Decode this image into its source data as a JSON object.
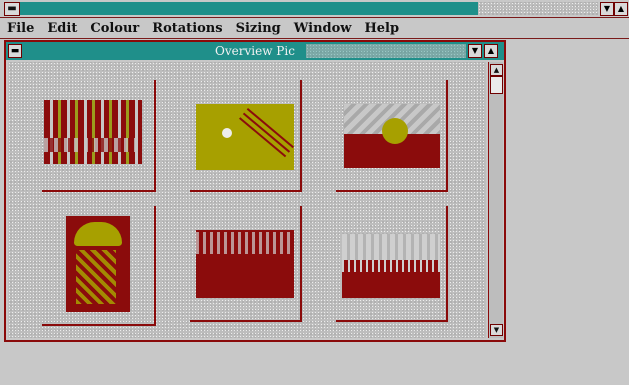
{
  "app": {
    "sysmenu_glyph": "▬",
    "minimize_glyph": "▼",
    "maximize_glyph": "▲"
  },
  "menubar": {
    "items": [
      "File",
      "Edit",
      "Colour",
      "Rotations",
      "Sizing",
      "Window",
      "Help"
    ]
  },
  "child_window": {
    "title": "Overview Pic",
    "sysmenu_glyph": "▬",
    "minimize_glyph": "▼",
    "maximize_glyph": "▲",
    "scroll_up_glyph": "▲",
    "scroll_down_glyph": "▼"
  },
  "thumbnails": [
    {
      "name": "thumbnail-1"
    },
    {
      "name": "thumbnail-2"
    },
    {
      "name": "thumbnail-3"
    },
    {
      "name": "thumbnail-4"
    },
    {
      "name": "thumbnail-5"
    },
    {
      "name": "thumbnail-6"
    }
  ],
  "colors": {
    "title_teal": "#1f8f8a",
    "frame_red": "#8a0a0a",
    "thumb_olive": "#a7a000"
  }
}
